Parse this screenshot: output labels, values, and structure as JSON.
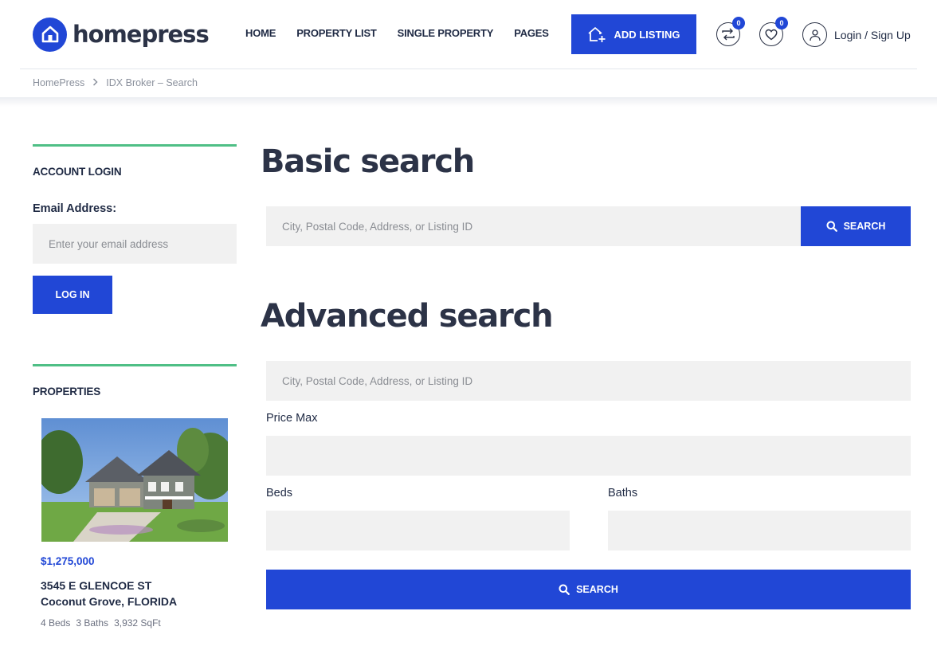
{
  "brand": {
    "name": "homepress",
    "color": "#2147d6",
    "accent_green": "#4fbf86"
  },
  "nav": {
    "items": [
      "HOME",
      "PROPERTY LIST",
      "SINGLE PROPERTY",
      "PAGES"
    ],
    "add_listing": "ADD LISTING",
    "compare_count": "0",
    "favorites_count": "0",
    "login": "Login / Sign Up"
  },
  "breadcrumb": {
    "home": "HomePress",
    "current": "IDX Broker – Search"
  },
  "sidebar": {
    "account_title": "ACCOUNT LOGIN",
    "email_label": "Email Address:",
    "email_placeholder": "Enter your email address",
    "login_button": "LOG IN",
    "properties_title": "PROPERTIES",
    "property": {
      "price": "$1,275,000",
      "address_line1": "3545 E GLENCOE ST",
      "address_line2": "Coconut Grove, FLORIDA",
      "beds": "4 Beds",
      "baths": "3 Baths",
      "sqft": "3,932 SqFt"
    }
  },
  "main": {
    "basic_title": "Basic search",
    "basic_placeholder": "City, Postal Code, Address, or Listing ID",
    "basic_button": "SEARCH",
    "advanced_title": "Advanced search",
    "advanced_placeholder": "City, Postal Code, Address, or Listing ID",
    "price_max_label": "Price Max",
    "beds_label": "Beds",
    "baths_label": "Baths",
    "advanced_button": "SEARCH"
  }
}
